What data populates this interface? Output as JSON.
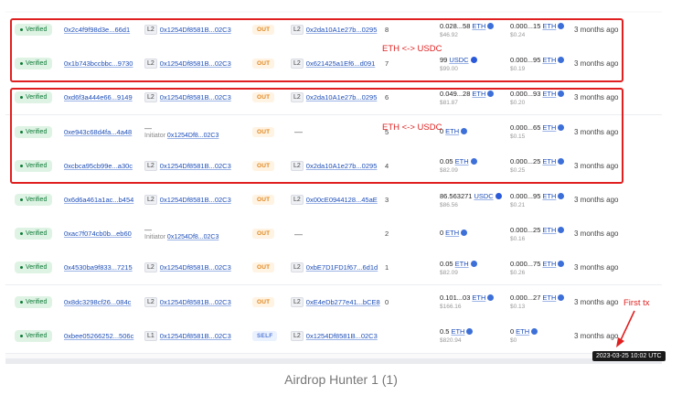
{
  "rows": [
    {
      "status": "Verified",
      "hash": "0x2c4f9f98d3e...66d1",
      "from_layer": "L2",
      "from": "0x1254Df8581B...02C3",
      "from_note": "",
      "dir": "OUT",
      "to_layer": "L2",
      "to": "0x2da10A1e27b...0295",
      "nonce": "8",
      "value": "0.028...58",
      "value_token": "ETH",
      "value_usd": "$46.92",
      "fee": "0.000...15",
      "fee_token": "ETH",
      "fee_usd": "$0.24",
      "age": "3 months ago"
    },
    {
      "status": "Verified",
      "hash": "0x1b743bccbbc...9730",
      "from_layer": "L2",
      "from": "0x1254Df8581B...02C3",
      "from_note": "",
      "dir": "OUT",
      "to_layer": "L2",
      "to": "0x621425a1Ef6...d091",
      "nonce": "7",
      "value": "99",
      "value_token": "USDC",
      "value_usd": "$99.00",
      "fee": "0.000...95",
      "fee_token": "ETH",
      "fee_usd": "$0.19",
      "age": "3 months ago"
    },
    {
      "status": "Verified",
      "hash": "0xd6f3a444e66...9149",
      "from_layer": "L2",
      "from": "0x1254Df8581B...02C3",
      "from_note": "",
      "dir": "OUT",
      "to_layer": "L2",
      "to": "0x2da10A1e27b...0295",
      "nonce": "6",
      "value": "0.049...28",
      "value_token": "ETH",
      "value_usd": "$81.87",
      "fee": "0.000...93",
      "fee_token": "ETH",
      "fee_usd": "$0.20",
      "age": "3 months ago"
    },
    {
      "status": "Verified",
      "hash": "0xe943c68d4fa...4a48",
      "from_layer": "",
      "from": "0x1254Df8...02C3",
      "from_note": "Initiator",
      "dir": "OUT",
      "to_layer": "",
      "to": "—",
      "nonce": "5",
      "value": "0",
      "value_token": "ETH",
      "value_usd": "",
      "fee": "0.000...65",
      "fee_token": "ETH",
      "fee_usd": "$0.15",
      "age": "3 months ago"
    },
    {
      "status": "Verified",
      "hash": "0xcbca95cb99e...a30c",
      "from_layer": "L2",
      "from": "0x1254Df8581B...02C3",
      "from_note": "",
      "dir": "OUT",
      "to_layer": "L2",
      "to": "0x2da10A1e27b...0295",
      "nonce": "4",
      "value": "0.05",
      "value_token": "ETH",
      "value_usd": "$82.09",
      "fee": "0.000...25",
      "fee_token": "ETH",
      "fee_usd": "$0.25",
      "age": "3 months ago"
    },
    {
      "status": "Verified",
      "hash": "0x6d6a461a1ac...b454",
      "from_layer": "L2",
      "from": "0x1254Df8581B...02C3",
      "from_note": "",
      "dir": "OUT",
      "to_layer": "L2",
      "to": "0x00cE0944128...45aE",
      "nonce": "3",
      "value": "86.563271",
      "value_token": "USDC",
      "value_usd": "$86.56",
      "fee": "0.000...95",
      "fee_token": "ETH",
      "fee_usd": "$0.21",
      "age": "3 months ago"
    },
    {
      "status": "Verified",
      "hash": "0xac7f074cb0b...eb60",
      "from_layer": "",
      "from": "0x1254Df8...02C3",
      "from_note": "Initiator",
      "dir": "OUT",
      "to_layer": "",
      "to": "—",
      "nonce": "2",
      "value": "0",
      "value_token": "ETH",
      "value_usd": "",
      "fee": "0.000...25",
      "fee_token": "ETH",
      "fee_usd": "$0.16",
      "age": "3 months ago"
    },
    {
      "status": "Verified",
      "hash": "0x4530ba9f833...7215",
      "from_layer": "L2",
      "from": "0x1254Df8581B...02C3",
      "from_note": "",
      "dir": "OUT",
      "to_layer": "L2",
      "to": "0xbE7D1FD1f67...6d1d",
      "nonce": "1",
      "value": "0.05",
      "value_token": "ETH",
      "value_usd": "$82.09",
      "fee": "0.000...75",
      "fee_token": "ETH",
      "fee_usd": "$0.26",
      "age": "3 months ago"
    },
    {
      "status": "Verified",
      "hash": "0x8dc3298cf26...084c",
      "from_layer": "L2",
      "from": "0x1254Df8581B...02C3",
      "from_note": "",
      "dir": "OUT",
      "to_layer": "L2",
      "to": "0xE4eDb277e41...bCE8",
      "nonce": "0",
      "value": "0.101...03",
      "value_token": "ETH",
      "value_usd": "$166.16",
      "fee": "0.000...27",
      "fee_token": "ETH",
      "fee_usd": "$0.13",
      "age": "3 months ago"
    },
    {
      "status": "Verified",
      "hash": "0xbee05266252...506c",
      "from_layer": "L1",
      "from": "0x1254Df8581B...02C3",
      "from_note": "",
      "dir": "SELF",
      "to_layer": "L2",
      "to": "0x1254Df8581B...02C3",
      "nonce": "",
      "value": "0.5",
      "value_token": "ETH",
      "value_usd": "$820.94",
      "fee": "0",
      "fee_token": "ETH",
      "fee_usd": "$0",
      "age": "3 months ago"
    }
  ],
  "annotations": {
    "box1_label": "ETH <-> USDC",
    "box2_label": "ETH <-> USDC",
    "first_tx_label": "First tx",
    "color": "#e02020"
  },
  "tooltip": {
    "text": "2023-03-25 10:02 UTC"
  },
  "caption": {
    "text": "Airdrop Hunter 1 (1)"
  }
}
